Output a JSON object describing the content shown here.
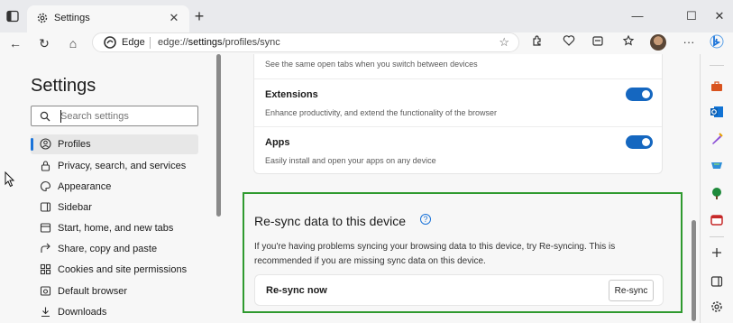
{
  "window": {
    "tab_title": "Settings",
    "new_tab_symbol": "+",
    "close_tab_symbol": "✕"
  },
  "addressbar": {
    "site_label": "Edge",
    "url_prefix": "edge://",
    "url_bold": "settings",
    "url_rest": "/profiles/sync"
  },
  "sidebar": {
    "title": "Settings",
    "search_placeholder": "Search settings",
    "items": [
      {
        "label": "Profiles",
        "icon": "profile-icon",
        "active": true
      },
      {
        "label": "Privacy, search, and services",
        "icon": "lock-icon"
      },
      {
        "label": "Appearance",
        "icon": "appearance-icon"
      },
      {
        "label": "Sidebar",
        "icon": "sidebar-icon"
      },
      {
        "label": "Start, home, and new tabs",
        "icon": "home-icon"
      },
      {
        "label": "Share, copy and paste",
        "icon": "share-icon"
      },
      {
        "label": "Cookies and site permissions",
        "icon": "cookies-icon"
      },
      {
        "label": "Default browser",
        "icon": "browser-icon"
      },
      {
        "label": "Downloads",
        "icon": "download-icon"
      }
    ]
  },
  "sync_card": {
    "open_tabs_desc": "See the same open tabs when you switch between devices",
    "extensions_title": "Extensions",
    "extensions_desc": "Enhance productivity, and extend the functionality of the browser",
    "extensions_on": true,
    "apps_title": "Apps",
    "apps_desc": "Easily install and open your apps on any device",
    "apps_on": true
  },
  "resync": {
    "title": "Re-sync data to this device",
    "desc": "If you're having problems syncing your browsing data to this device, try Re-syncing. This is recommended if you are missing sync data on this device.",
    "row_label": "Re-sync now",
    "button_label": "Re-sync",
    "highlight_color": "#2f9a2f"
  },
  "colors": {
    "accent": "#1567c0",
    "toggle_on": "#1567c0"
  }
}
